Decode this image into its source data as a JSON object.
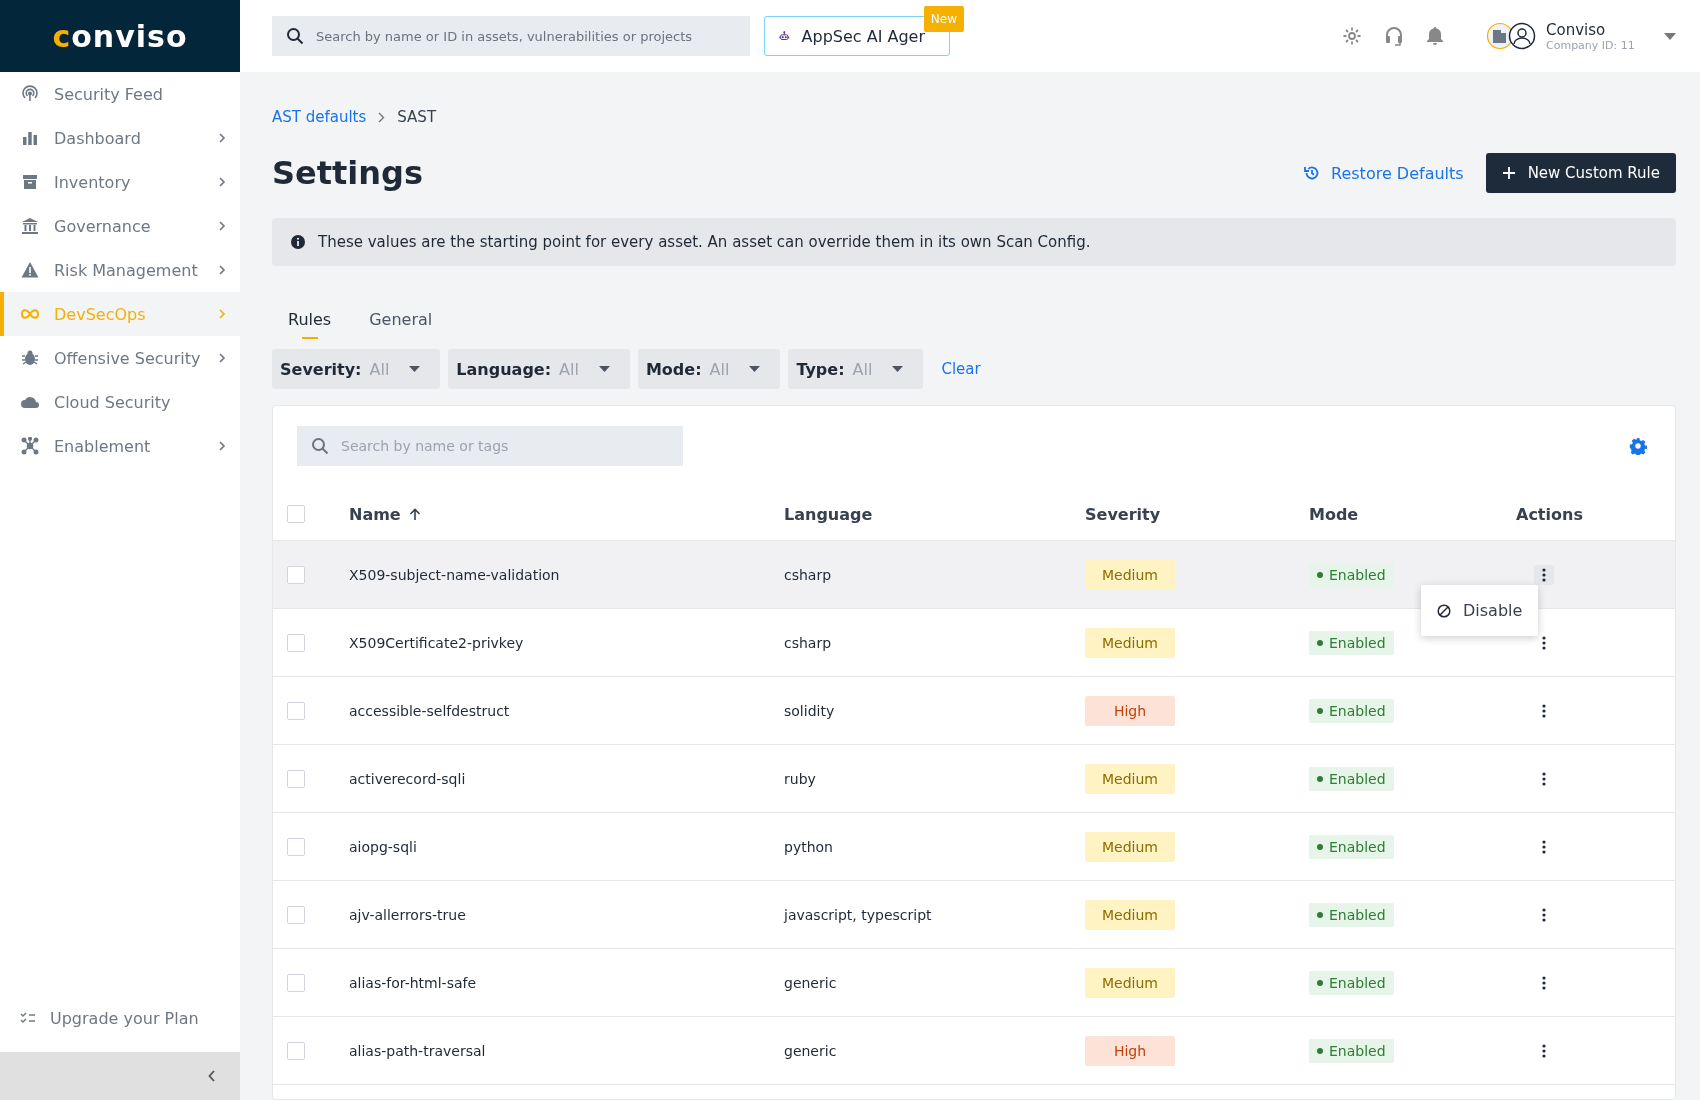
{
  "logo": "conviso",
  "sidebar": {
    "items": [
      {
        "label": "Security Feed",
        "expandable": false,
        "selected": false
      },
      {
        "label": "Dashboard",
        "expandable": true,
        "selected": false
      },
      {
        "label": "Inventory",
        "expandable": true,
        "selected": false
      },
      {
        "label": "Governance",
        "expandable": true,
        "selected": false
      },
      {
        "label": "Risk Management",
        "expandable": true,
        "selected": false
      },
      {
        "label": "DevSecOps",
        "expandable": true,
        "selected": true
      },
      {
        "label": "Offensive Security",
        "expandable": true,
        "selected": false
      },
      {
        "label": "Cloud Security",
        "expandable": false,
        "selected": false
      },
      {
        "label": "Enablement",
        "expandable": true,
        "selected": false
      }
    ],
    "upgrade": "Upgrade your Plan"
  },
  "header": {
    "search": {
      "placeholder": "Search by name or ID in assets, vulnerabilities or projects"
    },
    "ai_button": "AppSec AI Ager",
    "ai_badge": "New",
    "user": {
      "name": "Conviso",
      "company": "Company ID: 11"
    }
  },
  "breadcrumb": [
    {
      "label": "AST defaults",
      "link": true
    },
    {
      "label": "SAST",
      "link": false
    }
  ],
  "title": "Settings",
  "actions": {
    "restore": "Restore Defaults",
    "new_rule": "New Custom Rule"
  },
  "notice": "These values are the starting point for every asset. An asset can override them in its own Scan Config.",
  "tabs": [
    {
      "label": "Rules",
      "selected": true
    },
    {
      "label": "General",
      "selected": false
    }
  ],
  "filters": [
    {
      "label": "Severity:",
      "value": "All"
    },
    {
      "label": "Language:",
      "value": "All"
    },
    {
      "label": "Mode:",
      "value": "All"
    },
    {
      "label": "Type:",
      "value": "All"
    }
  ],
  "clear": "Clear",
  "table": {
    "search": {
      "placeholder": "Search by name or tags"
    },
    "header_checked": false,
    "columns": [
      {
        "label": "Name",
        "sorted": true
      },
      {
        "label": "Language",
        "sorted": false
      },
      {
        "label": "Severity",
        "sorted": false
      },
      {
        "label": "Mode",
        "sorted": false
      },
      {
        "label": "Actions",
        "sorted": false
      }
    ],
    "rows": [
      {
        "name": "X509-subject-name-validation",
        "language": "csharp",
        "severity": "Medium",
        "color": "#fff3c4",
        "mode": "Enabled",
        "checked": false,
        "highlighted": true,
        "menu": [
          "Disable"
        ]
      },
      {
        "name": "X509Certificate2-privkey",
        "language": "csharp",
        "severity": "Medium",
        "color": "#fff3c4",
        "mode": "Enabled",
        "checked": false,
        "highlighted": false
      },
      {
        "name": "accessible-selfdestruct",
        "language": "solidity",
        "severity": "High",
        "color": "#fde3d7",
        "mode": "Enabled",
        "checked": false,
        "highlighted": false
      },
      {
        "name": "activerecord-sqli",
        "language": "ruby",
        "severity": "Medium",
        "color": "#fff3c4",
        "mode": "Enabled",
        "checked": false,
        "highlighted": false
      },
      {
        "name": "aiopg-sqli",
        "language": "python",
        "severity": "Medium",
        "color": "#fff3c4",
        "mode": "Enabled",
        "checked": false,
        "highlighted": false
      },
      {
        "name": "ajv-allerrors-true",
        "language": "javascript, typescript",
        "severity": "Medium",
        "color": "#fff3c4",
        "mode": "Enabled",
        "checked": false,
        "highlighted": false
      },
      {
        "name": "alias-for-html-safe",
        "language": "generic",
        "severity": "Medium",
        "color": "#fff3c4",
        "mode": "Enabled",
        "checked": false,
        "highlighted": false
      },
      {
        "name": "alias-path-traversal",
        "language": "generic",
        "severity": "High",
        "color": "#fde3d7",
        "mode": "Enabled",
        "checked": false,
        "highlighted": false
      }
    ]
  }
}
